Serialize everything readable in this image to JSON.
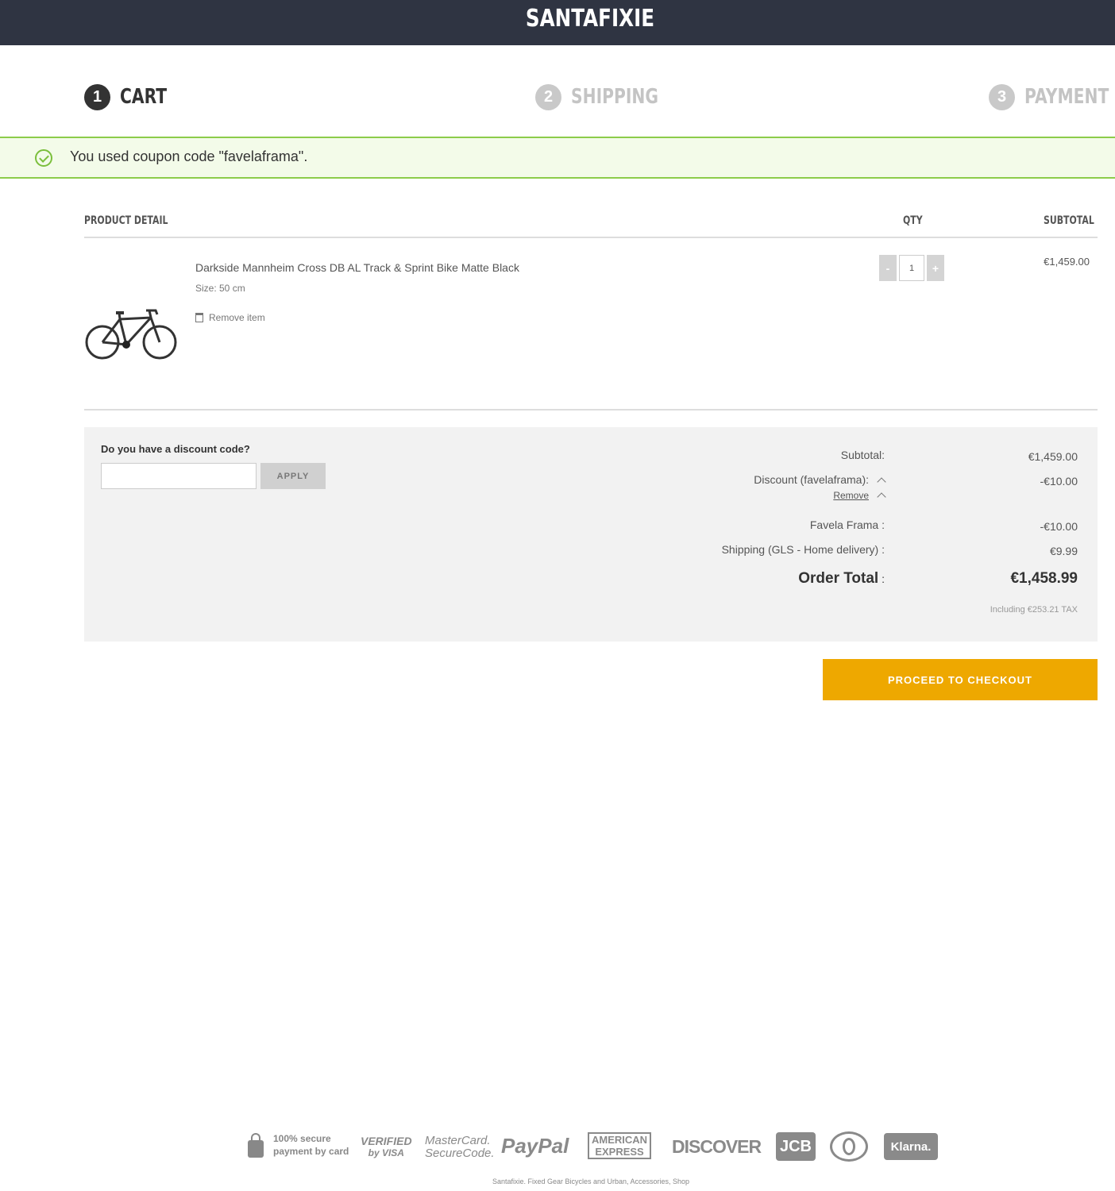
{
  "header": {
    "brand": "SANTAFIXIE"
  },
  "steps": [
    {
      "number": "1",
      "label": "CART"
    },
    {
      "number": "2",
      "label": "SHIPPING"
    },
    {
      "number": "3",
      "label": "PAYMENT"
    }
  ],
  "notice": {
    "text": "You used coupon code \"favelaframa\"."
  },
  "table": {
    "headers": {
      "product": "PRODUCT DETAIL",
      "qty": "QTY",
      "subtotal": "SUBTOTAL"
    }
  },
  "item": {
    "name": "Darkside Mannheim Cross DB AL Track & Sprint Bike Matte Black",
    "size": "Size:  50 cm",
    "remove_label": "Remove item",
    "qty": "1",
    "minus": "-",
    "plus": "+",
    "subtotal": "€1,459.00"
  },
  "discount": {
    "question": "Do you have a discount code?",
    "input_value": "",
    "apply_label": "APPLY"
  },
  "summary": {
    "subtotal_label": "Subtotal:",
    "subtotal_value": "€1,459.00",
    "discount_label": "Discount (favelaframa):",
    "discount_value": "-€10.00",
    "remove_label": "Remove",
    "favela_label": "Favela Frama :",
    "favela_value": "-€10.00",
    "shipping_label": "Shipping (GLS - Home delivery) :",
    "shipping_value": "€9.99",
    "total_label": "Order Total",
    "total_colon": " :",
    "total_value": "€1,458.99",
    "tax": "Including  €253.21  TAX"
  },
  "checkout_label": "PROCEED TO CHECKOUT",
  "footer": {
    "secure_line1": "100% secure",
    "secure_line2": "payment by card",
    "logos": {
      "visa_1": "VERIFIED",
      "visa_2": "by VISA",
      "mc_1": "MasterCard.",
      "mc_2": "SecureCode.",
      "paypal": "PayPal",
      "amex_1": "AMERICAN",
      "amex_2": "EXPRESS",
      "discover": "DISCOVER",
      "jcb": "JCB",
      "klarna": "Klarna."
    },
    "note": "Santafixie. Fixed Gear Bicycles and Urban, Accessories, Shop"
  }
}
